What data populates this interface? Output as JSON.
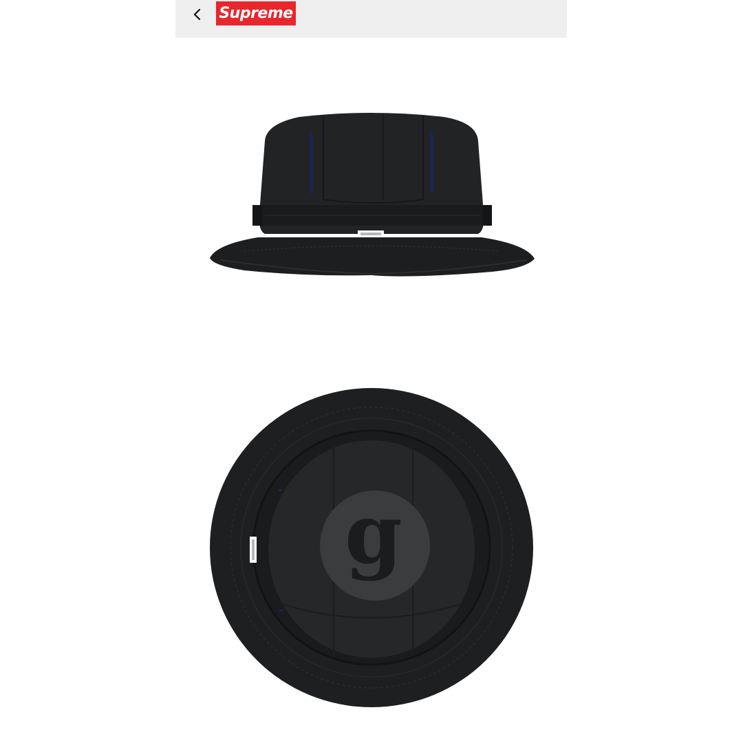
{
  "header": {
    "background": "#efefef",
    "back_icon": "chevron-left-icon",
    "brand": {
      "label": "Supreme",
      "color": "#e8262b"
    }
  },
  "gallery": {
    "images": [
      {
        "view": "side",
        "color": "#1e1f20",
        "accent": "#1a2553",
        "tag_color": "#ffffff"
      },
      {
        "view": "top",
        "color": "#1b1c1d",
        "emblem_letter": "g",
        "emblem_color": "#3b3c3e"
      }
    ]
  }
}
